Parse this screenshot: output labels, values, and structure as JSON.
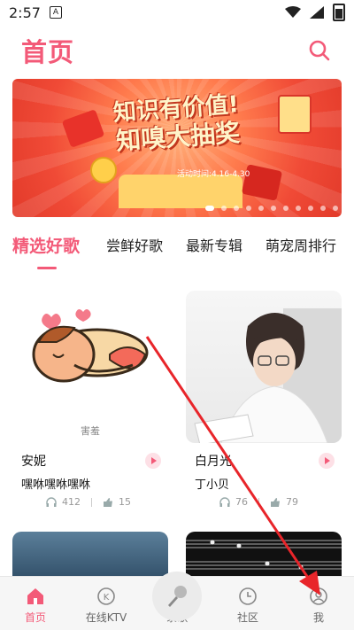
{
  "status_bar": {
    "time": "2:57",
    "notification_label": "A"
  },
  "header": {
    "title": "首页"
  },
  "banner": {
    "headline_line1": "知识有价值!",
    "headline_line2": "知嗅大抽奖",
    "date_text": "活动时间:4.16-4.30"
  },
  "tabs": [
    {
      "label": "精选好歌",
      "active": true
    },
    {
      "label": "尝鲜好歌",
      "active": false
    },
    {
      "label": "最新专辑",
      "active": false
    },
    {
      "label": "萌宠周排行",
      "active": false
    }
  ],
  "cards": [
    {
      "caption": "害羞",
      "title": "安妮",
      "singer": "嘿咻嘿咻嘿咻",
      "listens": "412",
      "likes": "15"
    },
    {
      "title": "白月光",
      "singer": "丁小贝",
      "listens": "76",
      "likes": "79"
    }
  ],
  "bottom_nav": [
    {
      "label": "首页",
      "icon": "home-icon",
      "active": true
    },
    {
      "label": "在线KTV",
      "icon": "ktv-icon",
      "active": false
    },
    {
      "label": "录歌",
      "icon": "microphone-icon",
      "active": false
    },
    {
      "label": "社区",
      "icon": "clock-icon",
      "active": false
    },
    {
      "label": "我",
      "icon": "user-icon",
      "active": false
    }
  ],
  "colors": {
    "accent": "#f35a78",
    "banner": "#f04a36",
    "annotation_arrow": "#e8252a"
  }
}
